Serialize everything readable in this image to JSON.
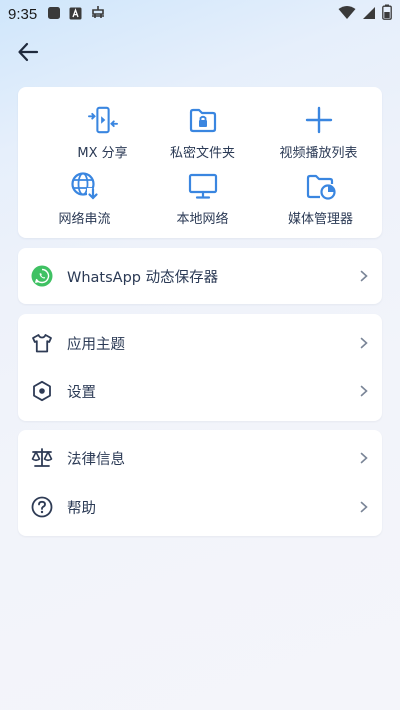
{
  "status_bar": {
    "time": "9:35",
    "icons_left": [
      "square-icon",
      "a-box-icon",
      "robot-icon"
    ],
    "icons_right": [
      "wifi-icon",
      "signal-icon",
      "battery-icon"
    ]
  },
  "header": {
    "back_icon": "arrow-left-icon"
  },
  "grid": {
    "items": [
      {
        "label": "MX 分享",
        "icon": "mx-share-icon"
      },
      {
        "label": "私密文件夹",
        "icon": "private-folder-icon"
      },
      {
        "label": "视频播放列表",
        "icon": "plus-icon"
      },
      {
        "label": "网络串流",
        "icon": "network-stream-icon"
      },
      {
        "label": "本地网络",
        "icon": "monitor-icon"
      },
      {
        "label": "媒体管理器",
        "icon": "media-manager-icon"
      }
    ]
  },
  "menu": {
    "whatsapp": {
      "label": "WhatsApp 动态保存器",
      "icon": "whatsapp-icon"
    },
    "theme": {
      "label": "应用主题",
      "icon": "shirt-icon"
    },
    "settings": {
      "label": "设置",
      "icon": "hexagon-settings-icon"
    },
    "legal": {
      "label": "法律信息",
      "icon": "scales-icon"
    },
    "help": {
      "label": "帮助",
      "icon": "help-circle-icon"
    }
  },
  "colors": {
    "accent": "#3a86e0",
    "text": "#2b3a55",
    "icon_dark": "#2e3b55",
    "whatsapp": "#3fc163"
  }
}
